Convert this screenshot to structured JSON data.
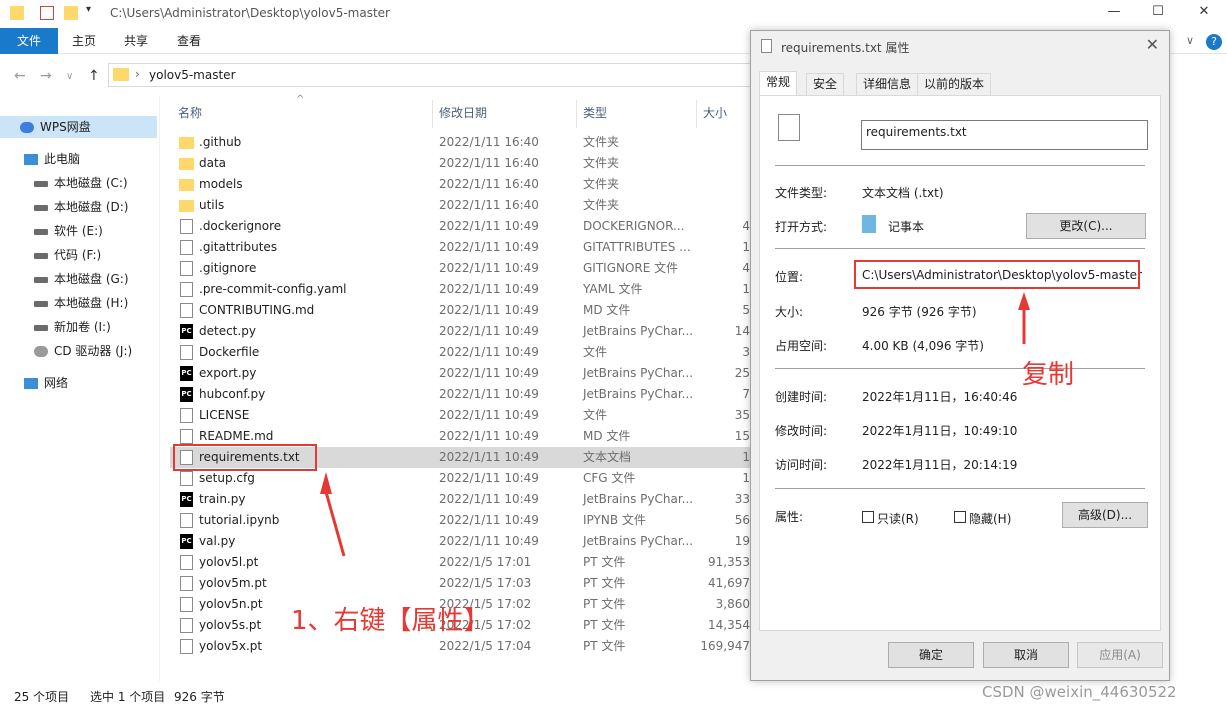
{
  "window": {
    "path": "C:\\Users\\Administrator\\Desktop\\yolov5-master"
  },
  "ribbon": {
    "tabs": [
      "文件",
      "主页",
      "共享",
      "查看"
    ]
  },
  "address": {
    "path": "yolov5-master"
  },
  "nav": {
    "items": [
      {
        "label": "WPS网盘",
        "kind": "cloud"
      },
      {
        "label": "此电脑",
        "kind": "pc"
      },
      {
        "label": "本地磁盘 (C:)",
        "kind": "drive"
      },
      {
        "label": "本地磁盘 (D:)",
        "kind": "drive"
      },
      {
        "label": "软件 (E:)",
        "kind": "drive"
      },
      {
        "label": "代码 (F:)",
        "kind": "drive"
      },
      {
        "label": "本地磁盘 (G:)",
        "kind": "drive"
      },
      {
        "label": "本地磁盘 (H:)",
        "kind": "drive"
      },
      {
        "label": "新加卷 (I:)",
        "kind": "drive"
      },
      {
        "label": "CD 驱动器 (J:)",
        "kind": "cd"
      },
      {
        "label": "网络",
        "kind": "network"
      }
    ]
  },
  "columns": {
    "name": "名称",
    "date": "修改日期",
    "type": "类型",
    "size": "大小"
  },
  "files": [
    {
      "name": ".github",
      "date": "2022/1/11 16:40",
      "type": "文件夹",
      "size": "",
      "icon": "folder"
    },
    {
      "name": "data",
      "date": "2022/1/11 16:40",
      "type": "文件夹",
      "size": "",
      "icon": "folder"
    },
    {
      "name": "models",
      "date": "2022/1/11 16:40",
      "type": "文件夹",
      "size": "",
      "icon": "folder"
    },
    {
      "name": "utils",
      "date": "2022/1/11 16:40",
      "type": "文件夹",
      "size": "",
      "icon": "folder"
    },
    {
      "name": ".dockerignore",
      "date": "2022/1/11 10:49",
      "type": "DOCKERIGNOR...",
      "size": "4",
      "icon": "doc"
    },
    {
      "name": ".gitattributes",
      "date": "2022/1/11 10:49",
      "type": "GITATTRIBUTES ...",
      "size": "1",
      "icon": "doc"
    },
    {
      "name": ".gitignore",
      "date": "2022/1/11 10:49",
      "type": "GITIGNORE 文件",
      "size": "4",
      "icon": "doc"
    },
    {
      "name": ".pre-commit-config.yaml",
      "date": "2022/1/11 10:49",
      "type": "YAML 文件",
      "size": "1",
      "icon": "doc"
    },
    {
      "name": "CONTRIBUTING.md",
      "date": "2022/1/11 10:49",
      "type": "MD 文件",
      "size": "5",
      "icon": "doc"
    },
    {
      "name": "detect.py",
      "date": "2022/1/11 10:49",
      "type": "JetBrains PyChar...",
      "size": "14",
      "icon": "pc"
    },
    {
      "name": "Dockerfile",
      "date": "2022/1/11 10:49",
      "type": "文件",
      "size": "3",
      "icon": "doc"
    },
    {
      "name": "export.py",
      "date": "2022/1/11 10:49",
      "type": "JetBrains PyChar...",
      "size": "25",
      "icon": "pc"
    },
    {
      "name": "hubconf.py",
      "date": "2022/1/11 10:49",
      "type": "JetBrains PyChar...",
      "size": "7",
      "icon": "pc"
    },
    {
      "name": "LICENSE",
      "date": "2022/1/11 10:49",
      "type": "文件",
      "size": "35",
      "icon": "doc"
    },
    {
      "name": "README.md",
      "date": "2022/1/11 10:49",
      "type": "MD 文件",
      "size": "15",
      "icon": "doc"
    },
    {
      "name": "requirements.txt",
      "date": "2022/1/11 10:49",
      "type": "文本文档",
      "size": "1",
      "icon": "doc",
      "selected": true
    },
    {
      "name": "setup.cfg",
      "date": "2022/1/11 10:49",
      "type": "CFG 文件",
      "size": "1",
      "icon": "doc"
    },
    {
      "name": "train.py",
      "date": "2022/1/11 10:49",
      "type": "JetBrains PyChar...",
      "size": "33",
      "icon": "pc"
    },
    {
      "name": "tutorial.ipynb",
      "date": "2022/1/11 10:49",
      "type": "IPYNB 文件",
      "size": "56",
      "icon": "doc"
    },
    {
      "name": "val.py",
      "date": "2022/1/11 10:49",
      "type": "JetBrains PyChar...",
      "size": "19",
      "icon": "pc"
    },
    {
      "name": "yolov5l.pt",
      "date": "2022/1/5 17:01",
      "type": "PT 文件",
      "size": "91,353",
      "icon": "doc"
    },
    {
      "name": "yolov5m.pt",
      "date": "2022/1/5 17:03",
      "type": "PT 文件",
      "size": "41,697",
      "icon": "doc"
    },
    {
      "name": "yolov5n.pt",
      "date": "2022/1/5 17:02",
      "type": "PT 文件",
      "size": "3,860",
      "icon": "doc"
    },
    {
      "name": "yolov5s.pt",
      "date": "2022/1/5 17:02",
      "type": "PT 文件",
      "size": "14,354",
      "icon": "doc"
    },
    {
      "name": "yolov5x.pt",
      "date": "2022/1/5 17:04",
      "type": "PT 文件",
      "size": "169,947",
      "icon": "doc"
    }
  ],
  "status": {
    "count": "25 个项目",
    "selected": "选中 1 个项目",
    "size": "926 字节"
  },
  "dialog": {
    "title": "requirements.txt 属性",
    "tabs": [
      "常规",
      "安全",
      "详细信息",
      "以前的版本"
    ],
    "filename": "requirements.txt",
    "type_label": "文件类型:",
    "type_value": "文本文档 (.txt)",
    "open_label": "打开方式:",
    "open_value": "记事本",
    "change_button": "更改(C)...",
    "location_label": "位置:",
    "location_value": "C:\\Users\\Administrator\\Desktop\\yolov5-master",
    "size_label": "大小:",
    "size_value": "926 字节 (926 字节)",
    "disk_label": "占用空间:",
    "disk_value": "4.00 KB (4,096 字节)",
    "created_label": "创建时间:",
    "created_value": "2022年1月11日，16:40:46",
    "modified_label": "修改时间:",
    "modified_value": "2022年1月11日，10:49:10",
    "accessed_label": "访问时间:",
    "accessed_value": "2022年1月11日，20:14:19",
    "attr_label": "属性:",
    "readonly_label": "只读(R)",
    "hidden_label": "隐藏(H)",
    "advanced_button": "高级(D)...",
    "ok_button": "确定",
    "cancel_button": "取消",
    "apply_button": "应用(A)"
  },
  "annotations": {
    "step1": "1、右键【属性】",
    "copy": "复制",
    "watermark": "CSDN @weixin_44630522"
  }
}
